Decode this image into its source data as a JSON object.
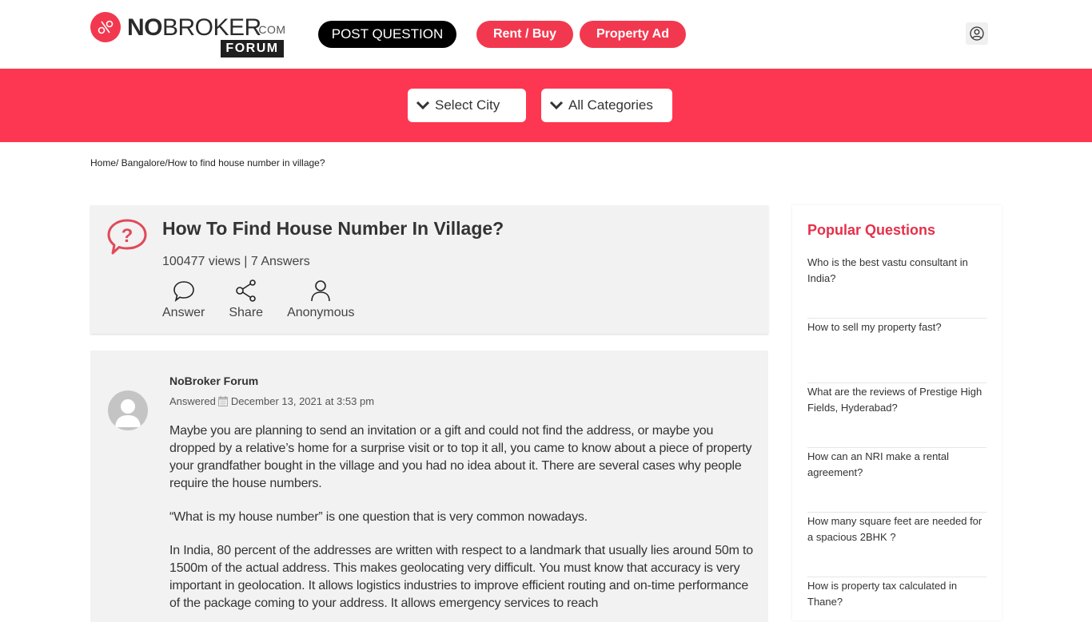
{
  "header": {
    "logo": {
      "no": "NO",
      "broker": "BROKER",
      "com": ".COM",
      "forum": "FORUM"
    },
    "post_question_label": "POST QUESTION",
    "rent_buy_label": "Rent / Buy",
    "property_ad_label": "Property Ad",
    "user_icon": "user-circle-icon"
  },
  "banner": {
    "city_select": "Select City",
    "category_select": "All Categories"
  },
  "breadcrumb": {
    "home": "Home/",
    "city": " Bangalore/",
    "current": "How to find house number in village?"
  },
  "question": {
    "title": "How To Find House Number In Village?",
    "meta": "100477 views | 7 Answers",
    "actions": [
      {
        "label": "Answer",
        "icon": "speech-bubble-icon"
      },
      {
        "label": "Share",
        "icon": "share-icon"
      },
      {
        "label": "Anonymous",
        "icon": "user-icon"
      }
    ]
  },
  "answer": {
    "author": "NoBroker Forum",
    "answered_label": "Answered",
    "date": "December 13, 2021 at 3:53 pm",
    "paragraphs": [
      "Maybe you are planning to send an invitation or a gift and could not find the address, or maybe you dropped by a relative’s home for a surprise visit or to top it all, you came to know about a piece of property your grandfather bought in the village and you had no idea about it. There are several cases why people require the house numbers.",
      "“What is my house number” is one question that is very common nowadays.",
      "In India, 80 percent of the addresses are written with respect to a landmark that usually lies around 50m to 1500m of the actual address. This makes geolocating very difficult. You must know that accuracy is very important in geolocation. It allows logistics industries to improve efficient routing and on-time performance of the package coming to your address. It allows emergency services to reach"
    ]
  },
  "sidebar": {
    "title": "Popular Questions",
    "items": [
      "Who is the best vastu consultant in India?",
      "How to sell my property fast?",
      "What are the reviews of Prestige High Fields, Hyderabad?",
      "How can an NRI make a rental agreement?",
      "How many square feet are needed for a spacious 2BHK ?",
      "How is property tax calculated in Thane?"
    ]
  },
  "colors": {
    "brand": "#f2384f",
    "banner": "#fd3752",
    "sidebar_title": "#e5304a"
  }
}
